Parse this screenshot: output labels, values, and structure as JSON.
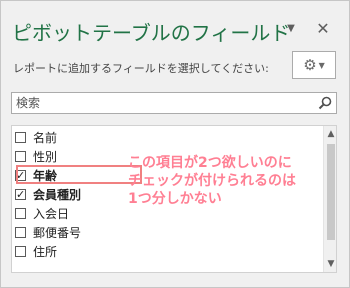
{
  "pane": {
    "title": "ピボットテーブルのフィールド",
    "dropdown_icon": "chevron-down-icon",
    "close_icon": "close-icon",
    "close_glyph": "✕",
    "dropdown_glyph": "▼"
  },
  "instruction": "レポートに追加するフィールドを選択してください:",
  "tools_button": {
    "icon": "gear-icon",
    "gear_glyph": "⚙",
    "caret_glyph": "▼"
  },
  "search": {
    "placeholder": "検索",
    "icon": "search-icon"
  },
  "fields": [
    {
      "label": "名前",
      "checked": false,
      "bold": false
    },
    {
      "label": "性別",
      "checked": false,
      "bold": false
    },
    {
      "label": "年齢",
      "checked": true,
      "bold": true
    },
    {
      "label": "会員種別",
      "checked": true,
      "bold": true
    },
    {
      "label": "入会日",
      "checked": false,
      "bold": false
    },
    {
      "label": "郵便番号",
      "checked": false,
      "bold": false
    },
    {
      "label": "住所",
      "checked": false,
      "bold": false
    }
  ],
  "check_glyph": "✓",
  "annotation": {
    "lines": [
      "この項目が2つ欲しいのに",
      "チェックが付けられるのは",
      "1つ分しかない"
    ],
    "color": "#ff7f93"
  },
  "scrollbar": {
    "up_glyph": "▲",
    "down_glyph": "▼"
  },
  "colors": {
    "title": "#217346",
    "annotation": "#ff7f93",
    "highlight": "#f08080"
  }
}
